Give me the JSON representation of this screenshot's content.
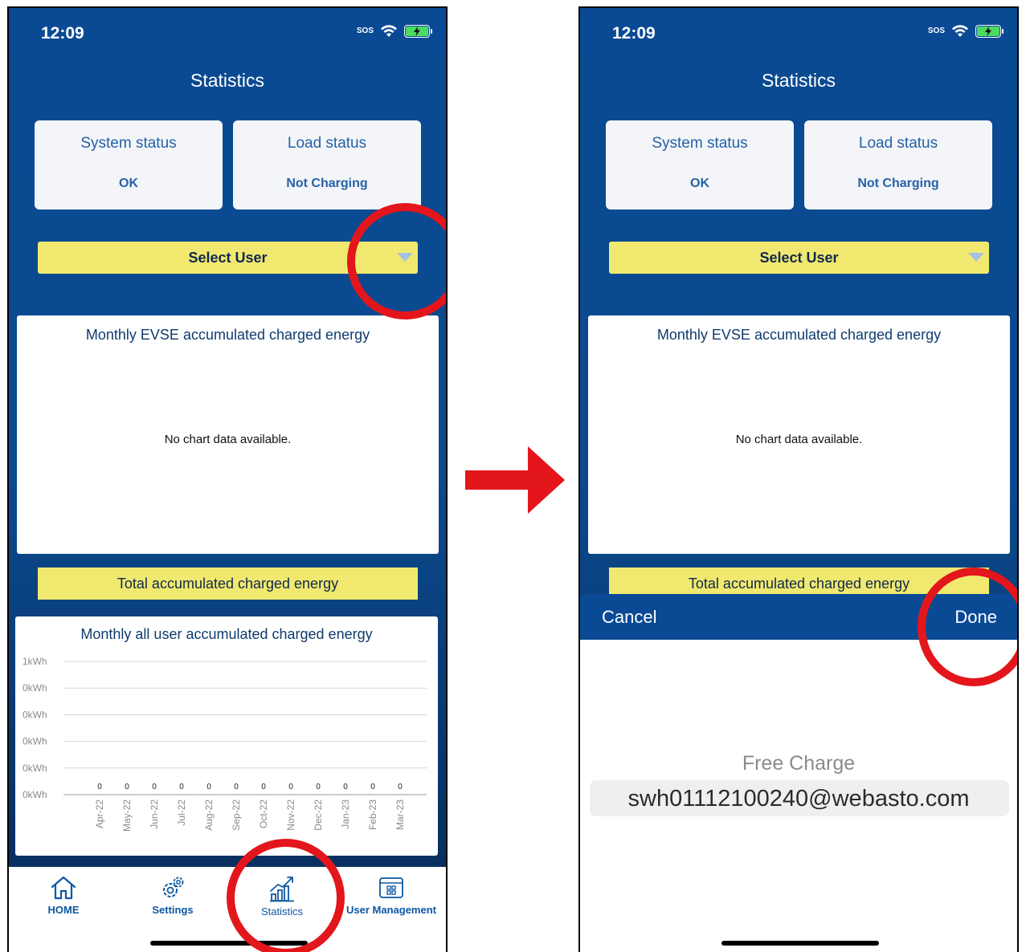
{
  "status_bar": {
    "time": "12:09",
    "sos": "SOS"
  },
  "page": {
    "title": "Statistics"
  },
  "cards": {
    "system": {
      "label": "System status",
      "value": "OK"
    },
    "load": {
      "label": "Load status",
      "value": "Not Charging"
    }
  },
  "select_user": {
    "label": "Select User"
  },
  "evse_chart": {
    "title": "Monthly EVSE accumulated charged energy",
    "empty_text": "No chart data available."
  },
  "total": {
    "label": "Total accumulated charged energy"
  },
  "chart_data": {
    "type": "bar",
    "title": "Monthly all user accumulated charged energy",
    "categories": [
      "Apr-22",
      "May-22",
      "Jun-22",
      "Jul-22",
      "Aug-22",
      "Sep-22",
      "Oct-22",
      "Nov-22",
      "Dec-22",
      "Jan-23",
      "Feb-23",
      "Mar-23"
    ],
    "values": [
      0,
      0,
      0,
      0,
      0,
      0,
      0,
      0,
      0,
      0,
      0,
      0
    ],
    "value_labels": [
      "0",
      "0",
      "0",
      "0",
      "0",
      "0",
      "0",
      "0",
      "0",
      "0",
      "0",
      "0"
    ],
    "ytick_labels": [
      "1kWh",
      "0kWh",
      "0kWh",
      "0kWh",
      "0kWh",
      "0kWh"
    ],
    "ylim": [
      0,
      1
    ],
    "grid": true
  },
  "tabs": [
    {
      "label": "HOME",
      "icon": "home-icon"
    },
    {
      "label": "Settings",
      "icon": "gear-icon"
    },
    {
      "label": "Statistics",
      "icon": "statistics-icon"
    },
    {
      "label": "User Management",
      "icon": "user-management-icon"
    }
  ],
  "picker": {
    "cancel": "Cancel",
    "done": "Done",
    "options": [
      "Free Charge",
      "swh01112100240@webasto.com"
    ]
  },
  "colors": {
    "brand_blue": "#0a4a95",
    "accent_yellow": "#f1e96f",
    "highlight_red": "#e3161b"
  }
}
